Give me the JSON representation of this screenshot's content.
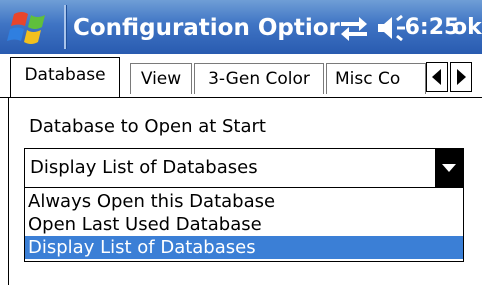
{
  "titlebar": {
    "title": "Configuration Optior",
    "clock": "6:25",
    "ok_label": "ok",
    "icons": [
      "windows-start-icon",
      "connectivity-icon",
      "volume-icon"
    ],
    "background": "#3f74c4"
  },
  "tabs": [
    {
      "label": "Database",
      "active": true
    },
    {
      "label": "View",
      "active": false
    },
    {
      "label": "3-Gen Color",
      "active": false
    },
    {
      "label": "Misc Co",
      "active": false
    }
  ],
  "tab_scroll": {
    "left_icon": "arrow-left-icon",
    "right_icon": "arrow-right-icon"
  },
  "database": {
    "label": "Database to Open at Start",
    "selected_value": "Display List of Databases",
    "options": [
      "Always Open this Database",
      "Open Last Used Database",
      "Display List of Databases"
    ],
    "selected_index": 2,
    "highlight_color": "#3b7fd6"
  }
}
